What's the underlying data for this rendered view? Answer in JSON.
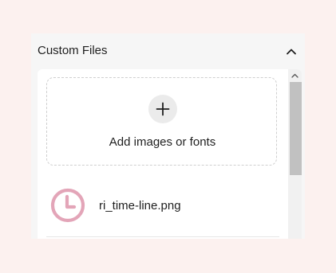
{
  "panel": {
    "title": "Custom Files",
    "collapse_icon": "chevron-up-icon"
  },
  "dropzone": {
    "icon": "plus-icon",
    "label": "Add images or fonts"
  },
  "files": [
    {
      "name": "ri_time-line.png",
      "thumbnail_icon": "clock-icon",
      "thumbnail_color": "#e3a5b8"
    }
  ],
  "colors": {
    "page_background": "#fcf1ef",
    "panel_background": "#f6f6f6",
    "content_background": "#ffffff",
    "scroll_thumb": "#c1c1c1"
  }
}
